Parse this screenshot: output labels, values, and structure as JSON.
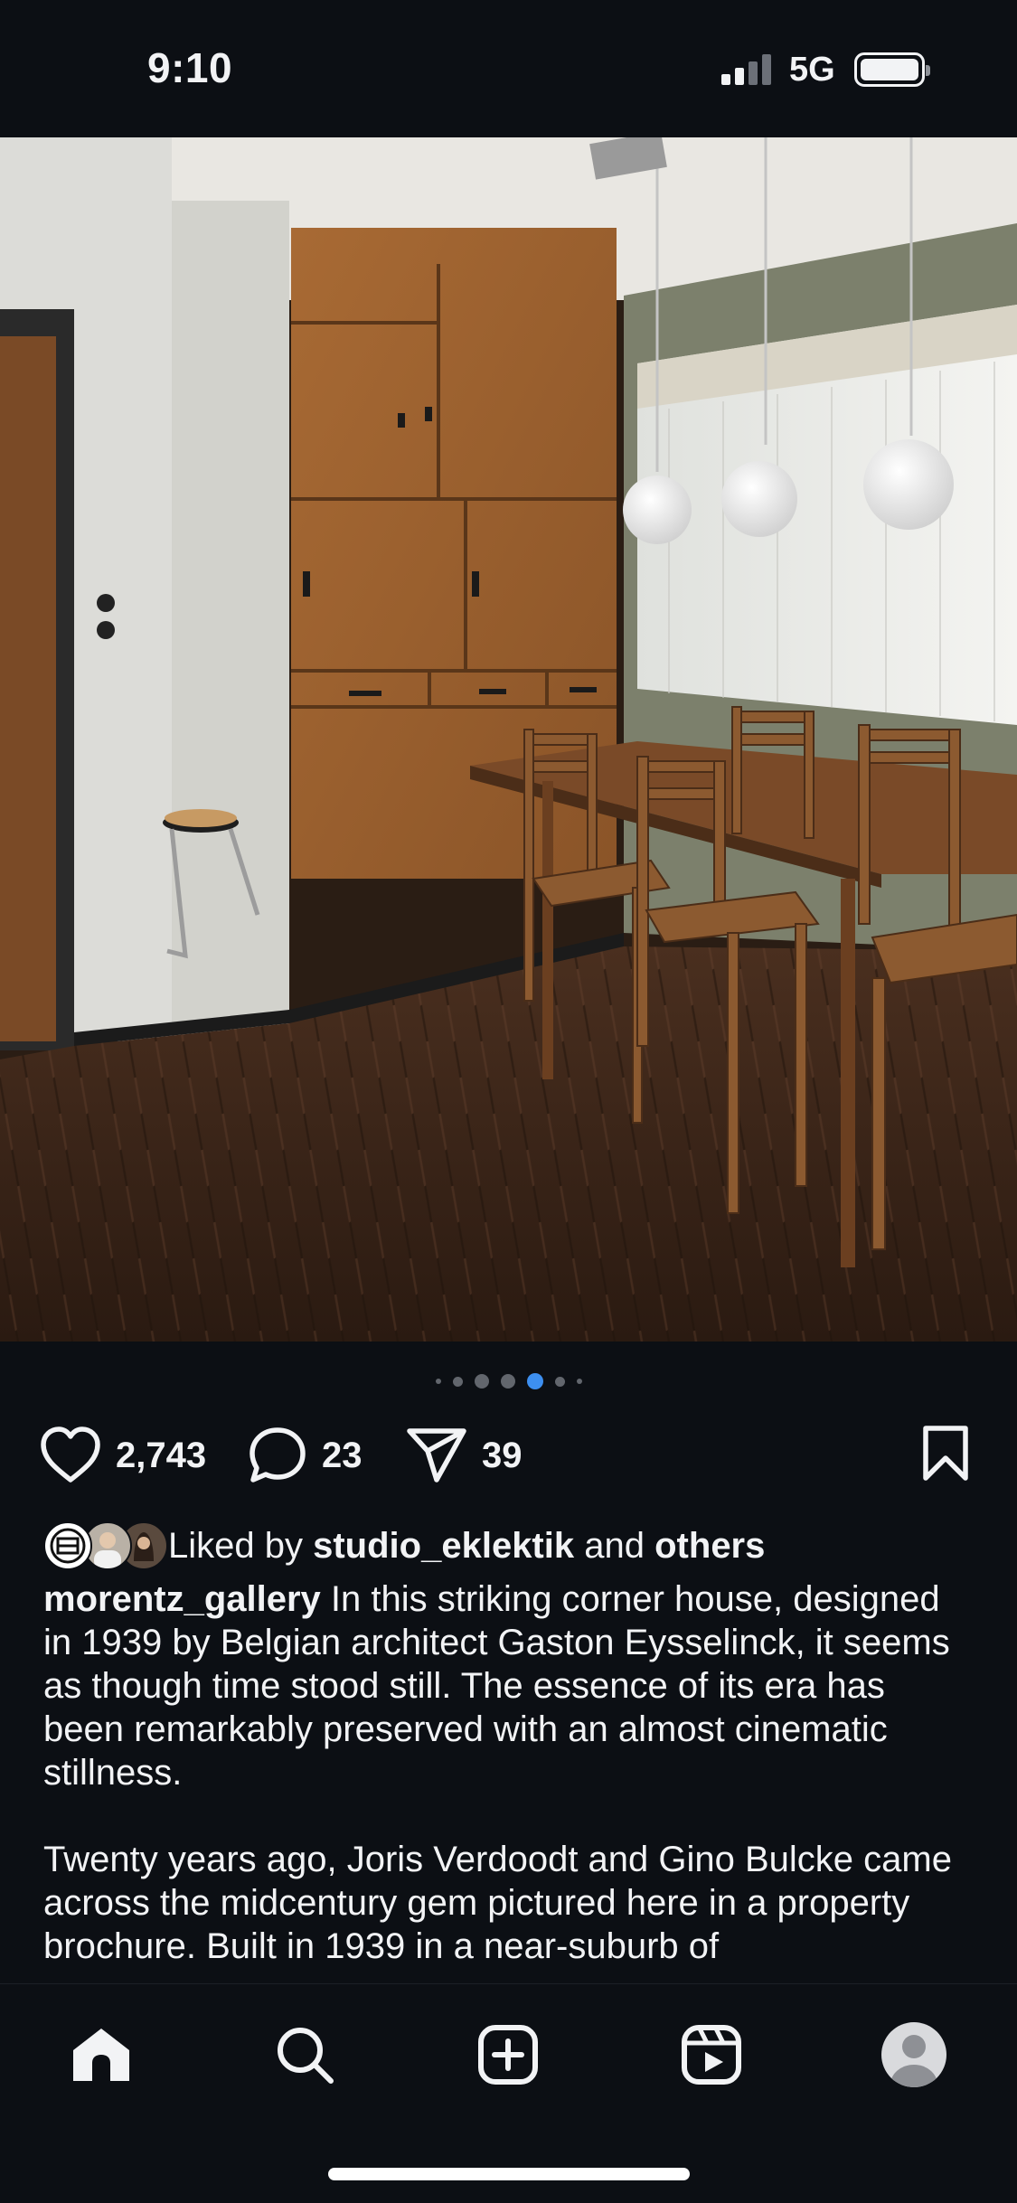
{
  "status_bar": {
    "time": "9:10",
    "network": "5G",
    "signal_bars_active": 2,
    "signal_bars_total": 4,
    "battery_level": 0.9
  },
  "post": {
    "image_alt": "Dining room with wooden cabinetry, herringbone parquet floor, table with chairs and globe pendant lights",
    "carousel": {
      "total": 7,
      "active_index": 4
    },
    "actions": {
      "likes": "2,743",
      "comments": "23",
      "shares": "39"
    },
    "liked_by": {
      "prefix": "Liked by",
      "user": "studio_eklektik",
      "conjunction": "and",
      "others": "others"
    },
    "caption": {
      "username": "morentz_gallery",
      "text": "In this striking corner house, designed in 1939 by Belgian architect Gaston Eysselinck, it seems as though time stood still. The essence of its era has been remarkably preserved with an almost cinematic stillness.",
      "paragraph2": "Twenty years ago, Joris Verdoodt and Gino Bulcke came across the midcentury gem pictured here in a property brochure. Built in 1939 in a near-suburb of"
    }
  },
  "bottom_nav": {
    "items": [
      "home-icon",
      "search-icon",
      "create-icon",
      "reels-icon",
      "profile-icon"
    ],
    "active": "home-icon"
  },
  "colors": {
    "background": "#0c0f14",
    "text": "#f2f3f5",
    "accent_dot": "#3d8ff0"
  }
}
